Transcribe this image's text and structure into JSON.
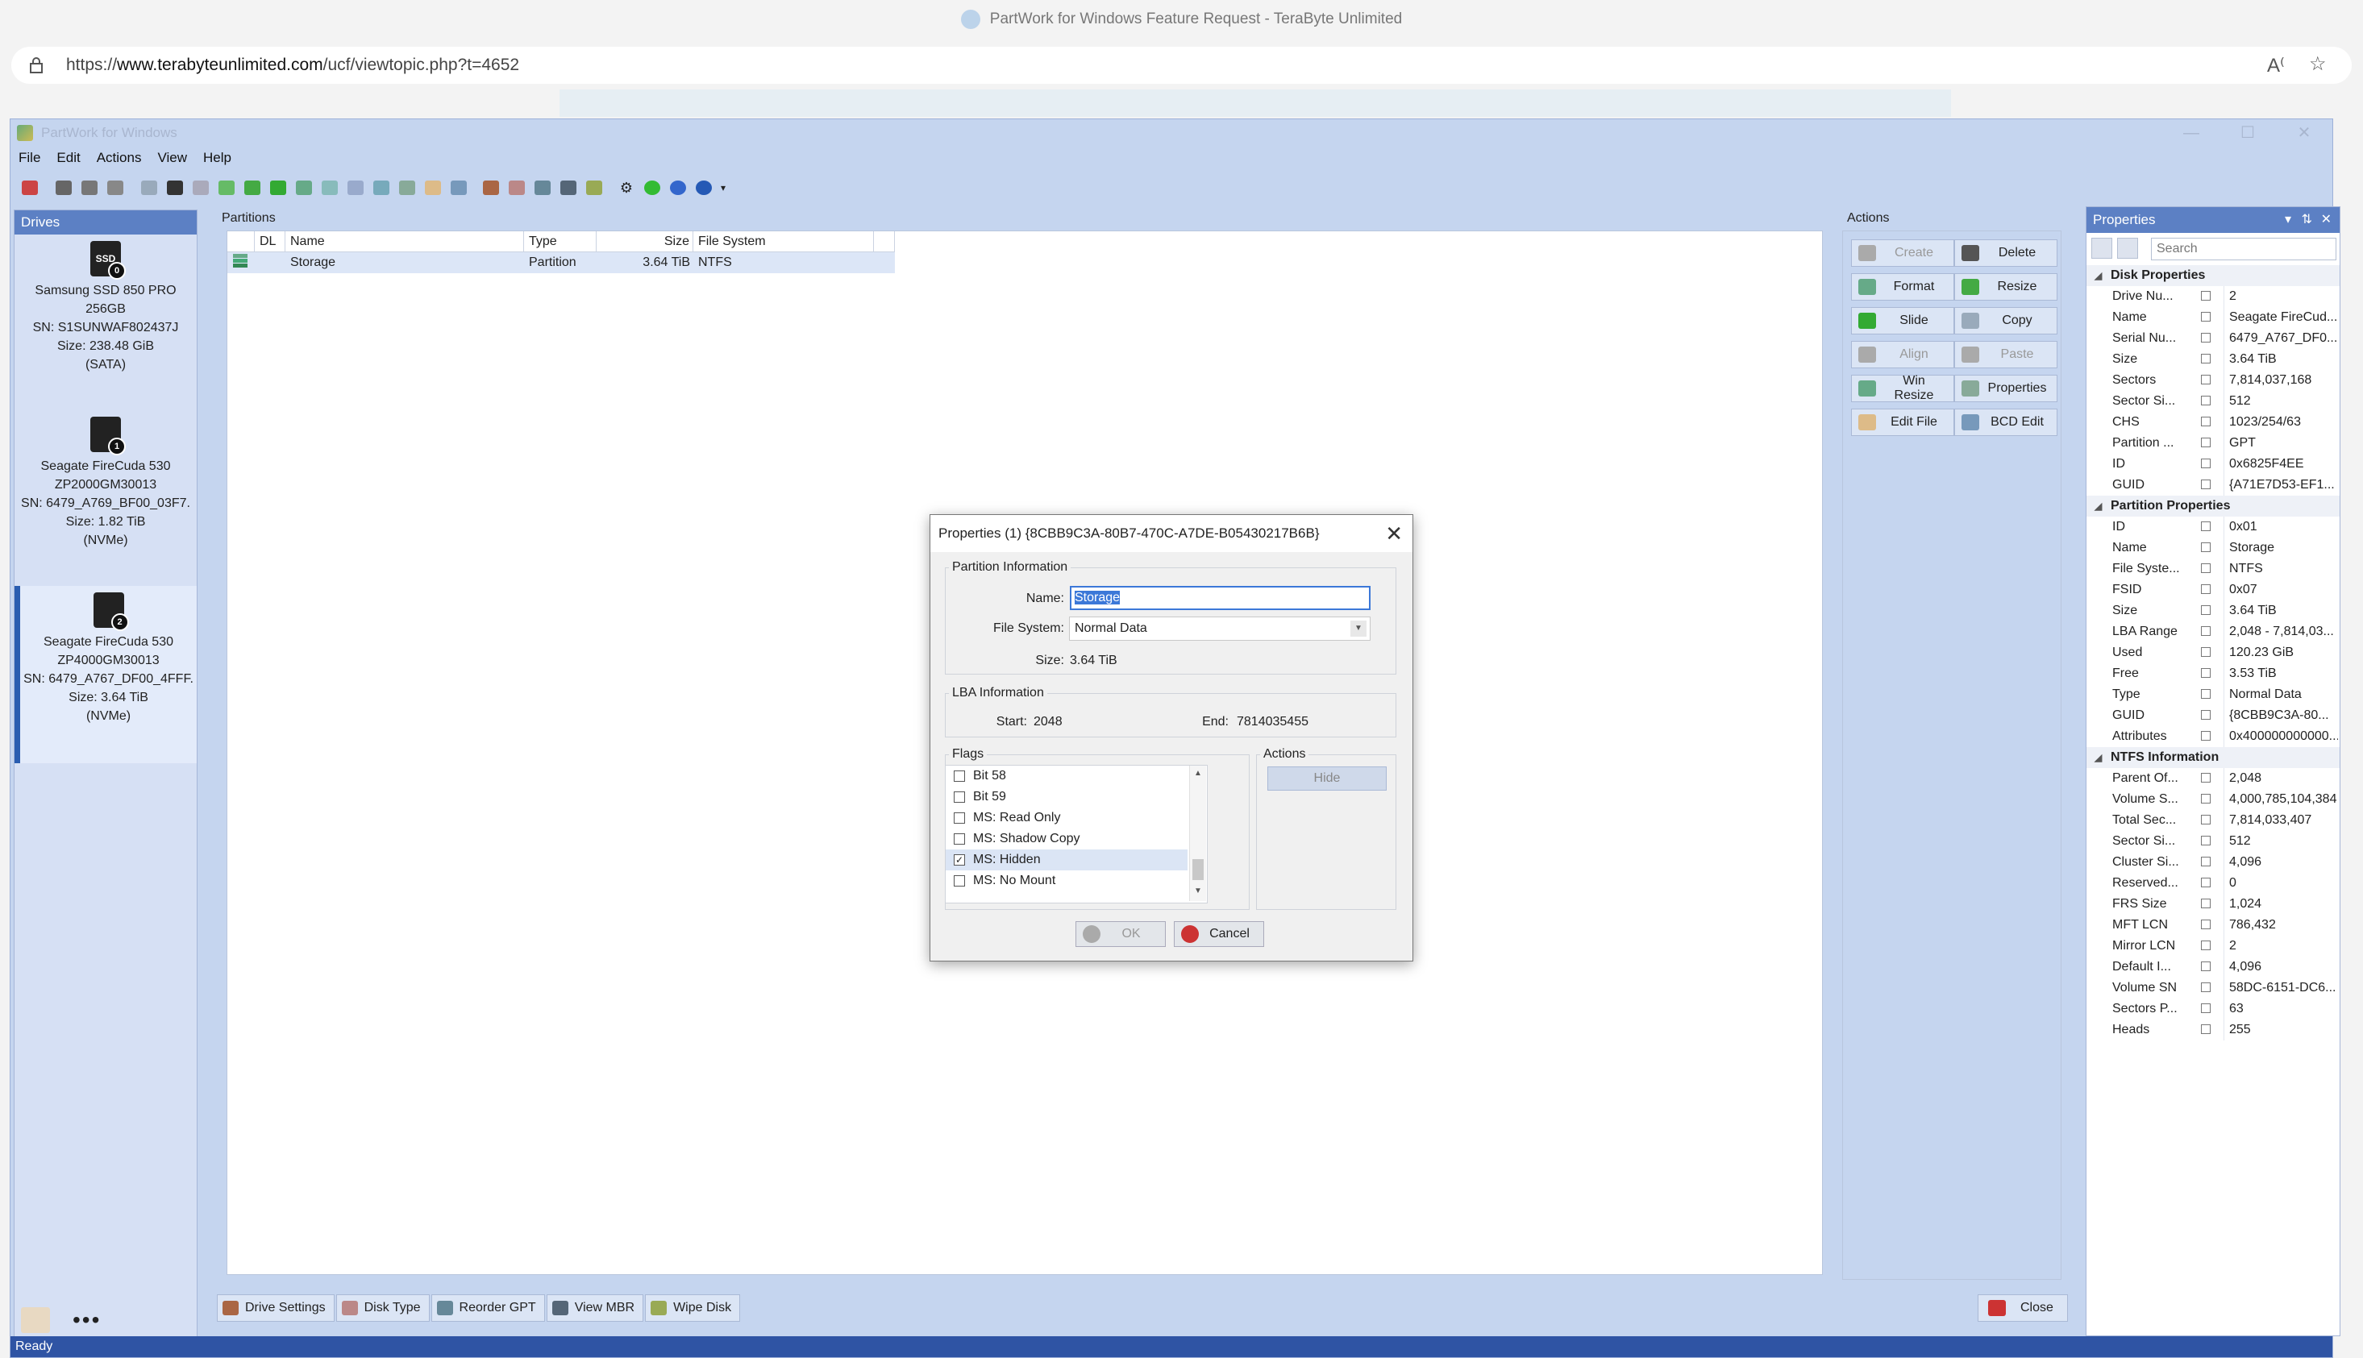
{
  "browser": {
    "tab_title": "PartWork for Windows Feature Request - TeraByte Unlimited",
    "url_prefix": "https://",
    "url_host": "www.terabyteunlimited.com",
    "url_path": "/ucf/viewtopic.php?t=4652"
  },
  "app": {
    "title": "PartWork for Windows",
    "menu": [
      "File",
      "Edit",
      "Actions",
      "View",
      "Help"
    ],
    "status": "Ready"
  },
  "drives": {
    "header": "Drives",
    "items": [
      {
        "icon_label": "SSD",
        "badge": "0",
        "line1": "Samsung SSD 850 PRO",
        "line2": "256GB",
        "line3": "SN: S1SUNWAF802437J",
        "line4": "Size: 238.48 GiB",
        "line5": "(SATA)"
      },
      {
        "icon_label": "",
        "badge": "1",
        "line1": "Seagate FireCuda 530",
        "line2": "ZP2000GM30013",
        "line3": "SN: 6479_A769_BF00_03F7.",
        "line4": "Size: 1.82 TiB",
        "line5": "(NVMe)"
      },
      {
        "icon_label": "",
        "badge": "2",
        "line1": "Seagate FireCuda 530",
        "line2": "ZP4000GM30013",
        "line3": "SN: 6479_A767_DF00_4FFF.",
        "line4": "Size: 3.64 TiB",
        "line5": "(NVMe)"
      }
    ],
    "more": "•••"
  },
  "partitions": {
    "label": "Partitions",
    "columns": [
      "DL",
      "Name",
      "Type",
      "Size",
      "File System"
    ],
    "rows": [
      {
        "dl": "",
        "name": "Storage",
        "type": "Partition",
        "size": "3.64 TiB",
        "fs": "NTFS"
      }
    ]
  },
  "actions": {
    "label": "Actions",
    "buttons": [
      "Create",
      "Delete",
      "Format",
      "Resize",
      "Slide",
      "Copy",
      "Align",
      "Paste",
      "Win Resize",
      "Properties",
      "Edit File",
      "BCD Edit"
    ]
  },
  "properties": {
    "header": "Properties",
    "search_placeholder": "Search",
    "sections": [
      {
        "title": "Disk Properties",
        "rows": [
          [
            "Drive Nu...",
            "2"
          ],
          [
            "Name",
            "Seagate FireCud..."
          ],
          [
            "Serial Nu...",
            "6479_A767_DF0..."
          ],
          [
            "Size",
            "3.64 TiB"
          ],
          [
            "Sectors",
            "7,814,037,168"
          ],
          [
            "Sector Si...",
            "512"
          ],
          [
            "CHS",
            "1023/254/63"
          ],
          [
            "Partition ...",
            "GPT"
          ],
          [
            "ID",
            "0x6825F4EE"
          ],
          [
            "GUID",
            "{A71E7D53-EF1..."
          ]
        ]
      },
      {
        "title": "Partition Properties",
        "rows": [
          [
            "ID",
            "0x01"
          ],
          [
            "Name",
            "Storage"
          ],
          [
            "File Syste...",
            "NTFS"
          ],
          [
            "FSID",
            "0x07"
          ],
          [
            "Size",
            "3.64 TiB"
          ],
          [
            "LBA Range",
            "2,048 - 7,814,03..."
          ],
          [
            "Used",
            "120.23 GiB"
          ],
          [
            "Free",
            "3.53 TiB"
          ],
          [
            "Type",
            "Normal Data"
          ],
          [
            "GUID",
            "{8CBB9C3A-80..."
          ],
          [
            "Attributes",
            "0x400000000000..."
          ]
        ]
      },
      {
        "title": "NTFS Information",
        "rows": [
          [
            "Parent Of...",
            "2,048"
          ],
          [
            "Volume S...",
            "4,000,785,104,384"
          ],
          [
            "Total Sec...",
            "7,814,033,407"
          ],
          [
            "Sector Si...",
            "512"
          ],
          [
            "Cluster Si...",
            "4,096"
          ],
          [
            "Reserved...",
            "0"
          ],
          [
            "FRS Size",
            "1,024"
          ],
          [
            "MFT LCN",
            "786,432"
          ],
          [
            "Mirror LCN",
            "2"
          ],
          [
            "Default I...",
            "4,096"
          ],
          [
            "Volume SN",
            "58DC-6151-DC6..."
          ],
          [
            "Sectors P...",
            "63"
          ],
          [
            "Heads",
            "255"
          ]
        ]
      }
    ]
  },
  "bottom_tabs": [
    "Drive Settings",
    "Disk Type",
    "Reorder GPT",
    "View MBR",
    "Wipe Disk"
  ],
  "close_label": "Close",
  "dialog": {
    "title": "Properties (1) {8CBB9C3A-80B7-470C-A7DE-B05430217B6B}",
    "partition_info_legend": "Partition Information",
    "name_label": "Name:",
    "name_value": "Storage",
    "fs_label": "File System:",
    "fs_value": "Normal Data",
    "size_label": "Size:",
    "size_value": "3.64 TiB",
    "lba_legend": "LBA Information",
    "start_label": "Start:",
    "start_value": "2048",
    "end_label": "End:",
    "end_value": "7814035455",
    "flags_legend": "Flags",
    "flags": [
      {
        "label": "Bit 58",
        "checked": false
      },
      {
        "label": "Bit 59",
        "checked": false
      },
      {
        "label": "MS: Read Only",
        "checked": false
      },
      {
        "label": "MS: Shadow Copy",
        "checked": false
      },
      {
        "label": "MS: Hidden",
        "checked": true
      },
      {
        "label": "MS: No Mount",
        "checked": false
      }
    ],
    "actions_legend": "Actions",
    "hide_label": "Hide",
    "ok_label": "OK",
    "cancel_label": "Cancel"
  }
}
